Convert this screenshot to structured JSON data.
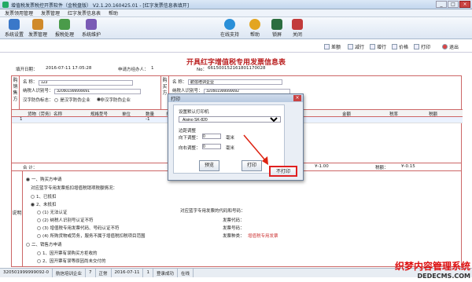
{
  "titlebar": {
    "title": "增值税发票税控开票软件（金税盘版） V2.1.20.160425.01 - [红字发票信息表填开]",
    "min": "_",
    "max": "□",
    "close": "×"
  },
  "menu": [
    "发票领用管理",
    "发票管理",
    "红字发票信息表",
    "帮助"
  ],
  "toolbar": {
    "left": [
      {
        "label": "系统设置",
        "color": "#3a78c9"
      },
      {
        "label": "发票管理",
        "color": "#d08a2a"
      },
      {
        "label": "报税处理",
        "color": "#4a9b4a"
      },
      {
        "label": "系统维护",
        "color": "#7a5bb5"
      }
    ],
    "right": [
      {
        "label": "在线支持",
        "color": "#2a8fd8"
      },
      {
        "label": "帮助",
        "color": "#e3a520"
      },
      {
        "label": "锁屏",
        "color": "#2b6d3f"
      },
      {
        "label": "关闭",
        "color": "#c23b3b"
      }
    ]
  },
  "page_toolbar": [
    "差额",
    "减行",
    "增行",
    "价格",
    "打印",
    "退出"
  ],
  "doc": {
    "title": "开具红字增值税专用发票信息表",
    "date_label": "填开日期：",
    "date_value": "2016-07-11 17:05:28",
    "applicant_label": "申请方经办人：",
    "applicant_value": "1",
    "no_label": "No：",
    "no_value": "661500152161801170028"
  },
  "buyer": {
    "side_label": "购销售方",
    "name_label": "名    称：",
    "name_value": "123",
    "tax_label": "纳税人识别号：",
    "tax_value": "320501999999091",
    "type_label": "汉字防伪标志：",
    "opt1": "是汉字防伪企业",
    "opt2": "非汉字防伪企业"
  },
  "seller": {
    "side_label": "购买方",
    "name_label": "名    称：",
    "name_value": "航信培训企业",
    "tax_label": "纳税人识别号：",
    "tax_value": "320501999999092"
  },
  "items": {
    "headers": [
      "货物（劳务）名称",
      "规格型号",
      "单位",
      "数量",
      "单价",
      "金额",
      "税率",
      "税额"
    ],
    "row": [
      "1",
      "",
      "",
      "",
      "-1"
    ]
  },
  "totals": {
    "label": "合    计：",
    "amount": "¥-1.00",
    "tax_label": "税额：",
    "tax": "¥-0.15"
  },
  "notes": {
    "side": "说明",
    "lines": [
      "一、购买方申请",
      "对应蓝字专用发票抵扣增值税销项税额情况：",
      "1、已抵扣",
      "2、未抵扣",
      "(1) 无法认证",
      "(2) 纳税人识别号认证不符",
      "(3) 增值税专用发票代码、号码认证不符",
      "(4) 所购货物或劳务，服务不属于增值税扣税项目范围",
      "二、销售方申请",
      "1、因开票有误购买方拒收的",
      "2、因开票有误等原因尚未交付的"
    ],
    "right_lines": [
      "对应蓝字专用发票密码区内打印的代码：",
      "对应蓝字专用发票的代码和号码：",
      "发票代码：",
      "发票号码：",
      "发票种类：",
      "增值税专用发票"
    ]
  },
  "status": [
    "320501999999092-0",
    "航信培训企业",
    "7",
    "正常",
    "2016-07-11",
    "1",
    "登录成功",
    "在线"
  ],
  "dialog": {
    "title": "打印",
    "close": "×",
    "printer_label": "设置默认打印机",
    "printer_value": "Aisino SK-820",
    "margin_label": "边距调整",
    "down_label": "向下调整：",
    "down_value": "0",
    "right_label": "向右调整：",
    "right_value": "0",
    "unit": "毫米",
    "btn_preview": "预览",
    "btn_print": "打印",
    "btn_noprint": "不打印"
  },
  "watermark": {
    "line1": "织梦内容管理系统",
    "line2": "DEDECMS.COM"
  }
}
